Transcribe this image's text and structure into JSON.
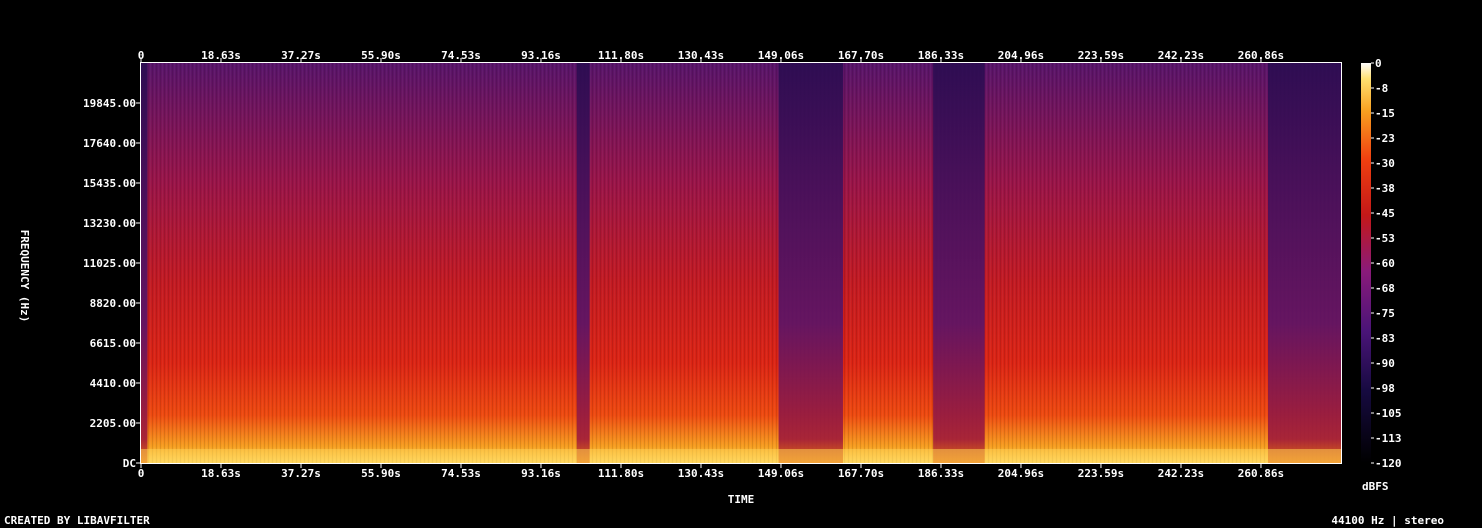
{
  "chart_data": {
    "type": "heatmap",
    "xlabel": "TIME",
    "ylabel": "FREQUENCY (Hz)",
    "x_ticks": [
      "0",
      "18.63s",
      "37.27s",
      "55.90s",
      "74.53s",
      "93.16s",
      "111.80s",
      "130.43s",
      "149.06s",
      "167.70s",
      "186.33s",
      "204.96s",
      "223.59s",
      "242.23s",
      "260.86s"
    ],
    "x_tick_values": [
      0,
      18.63,
      37.27,
      55.9,
      74.53,
      93.16,
      111.8,
      130.43,
      149.06,
      167.7,
      186.33,
      204.96,
      223.59,
      242.23,
      260.86
    ],
    "xlim": [
      0,
      279.5
    ],
    "y_ticks": [
      "DC",
      "2205.00",
      "4410.00",
      "6615.00",
      "8820.00",
      "11025.00",
      "13230.00",
      "15435.00",
      "17640.00",
      "19845.00"
    ],
    "y_tick_values": [
      0,
      2205,
      4410,
      6615,
      8820,
      11025,
      13230,
      15435,
      17640,
      19845
    ],
    "ylim": [
      0,
      22050
    ],
    "colorbar": {
      "label": "dBFS",
      "ticks": [
        "0",
        "-8",
        "-15",
        "-23",
        "-30",
        "-38",
        "-45",
        "-53",
        "-60",
        "-68",
        "-75",
        "-83",
        "-90",
        "-98",
        "-105",
        "-113",
        "-120"
      ],
      "range": [
        -120,
        0
      ]
    },
    "quiet_segments_s": [
      [
        0,
        1.5
      ],
      [
        101.5,
        104.5
      ],
      [
        148.5,
        163.5
      ],
      [
        184.5,
        196.5
      ],
      [
        262.5,
        279.5
      ]
    ],
    "colors": {
      "background": "#000000",
      "low": "#000000",
      "mid_low": "#3a1060",
      "mid": "#c41818",
      "mid_high": "#f07010",
      "high": "#ffffff"
    }
  },
  "footer": {
    "left": "CREATED BY LIBAVFILTER",
    "right": "44100 Hz | stereo"
  }
}
